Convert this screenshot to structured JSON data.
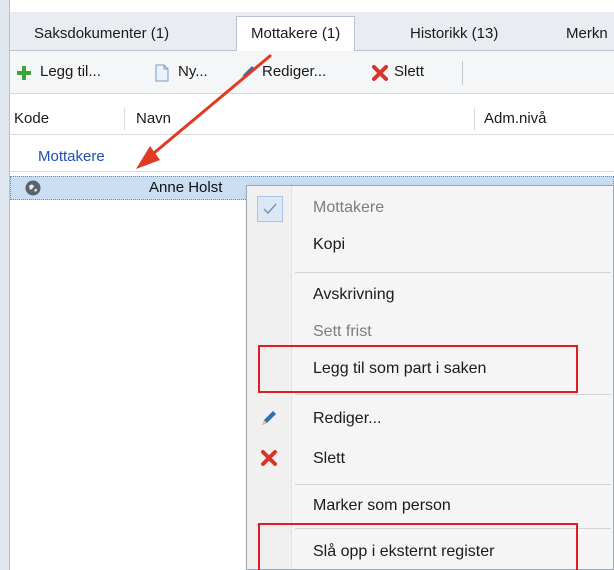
{
  "tabs": [
    {
      "label": "Saksdokumenter (1)"
    },
    {
      "label": "Mottakere (1)"
    },
    {
      "label": "Historikk (13)"
    },
    {
      "label": "Merkn"
    }
  ],
  "toolbar": {
    "add_label": "Legg til...",
    "new_label": "Ny...",
    "edit_label": "Rediger...",
    "delete_label": "Slett"
  },
  "grid": {
    "columns": [
      "Kode",
      "Navn",
      "Adm.nivå"
    ],
    "group_label": "Mottakere",
    "rows": [
      {
        "name": "Anne Holst"
      }
    ]
  },
  "context_menu": {
    "items": [
      {
        "label": "Mottakere",
        "disabled": true,
        "checked": true
      },
      {
        "label": "Kopi"
      },
      {
        "label": "Avskrivning"
      },
      {
        "label": "Sett frist",
        "disabled": true
      },
      {
        "label": "Legg til som part i saken"
      },
      {
        "label": "Rediger..."
      },
      {
        "label": "Slett"
      },
      {
        "label": "Marker som person"
      },
      {
        "label": "Slå opp i eksternt register"
      }
    ]
  },
  "colors": {
    "highlight": "#e01b24",
    "arrow": "#e03a22",
    "group_text": "#1f4fb3",
    "row_selected": "#c9def2"
  }
}
